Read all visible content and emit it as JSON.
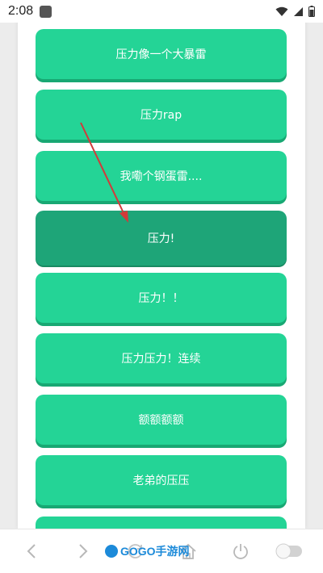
{
  "status_bar": {
    "time": "2:08",
    "icons": [
      "app-notification-icon",
      "wifi-icon",
      "signal-icon",
      "battery-icon"
    ]
  },
  "buttons": [
    {
      "label": "",
      "active": false
    },
    {
      "label": "压力像一个大暴雷",
      "active": false
    },
    {
      "label": "压力rap",
      "active": false
    },
    {
      "label": "我嘞个钢蛋雷....",
      "active": false
    },
    {
      "label": "压力!",
      "active": true
    },
    {
      "label": "压力！！",
      "active": false
    },
    {
      "label": "压力压力！连续",
      "active": false
    },
    {
      "label": "额额额额",
      "active": false
    },
    {
      "label": "老弟的压压",
      "active": false
    },
    {
      "label": "",
      "active": false
    }
  ],
  "nav_bar": {
    "icons": [
      "back-icon",
      "forward-icon",
      "refresh-icon",
      "home-icon",
      "power-icon",
      "toggle-icon"
    ]
  },
  "watermark": {
    "text": "GOGO手游网"
  },
  "colors": {
    "button": "#24d496",
    "button_shadow": "#18a873",
    "button_active": "#1ea578",
    "arrow": "#d23a3a",
    "watermark": "#1c8ad9"
  }
}
